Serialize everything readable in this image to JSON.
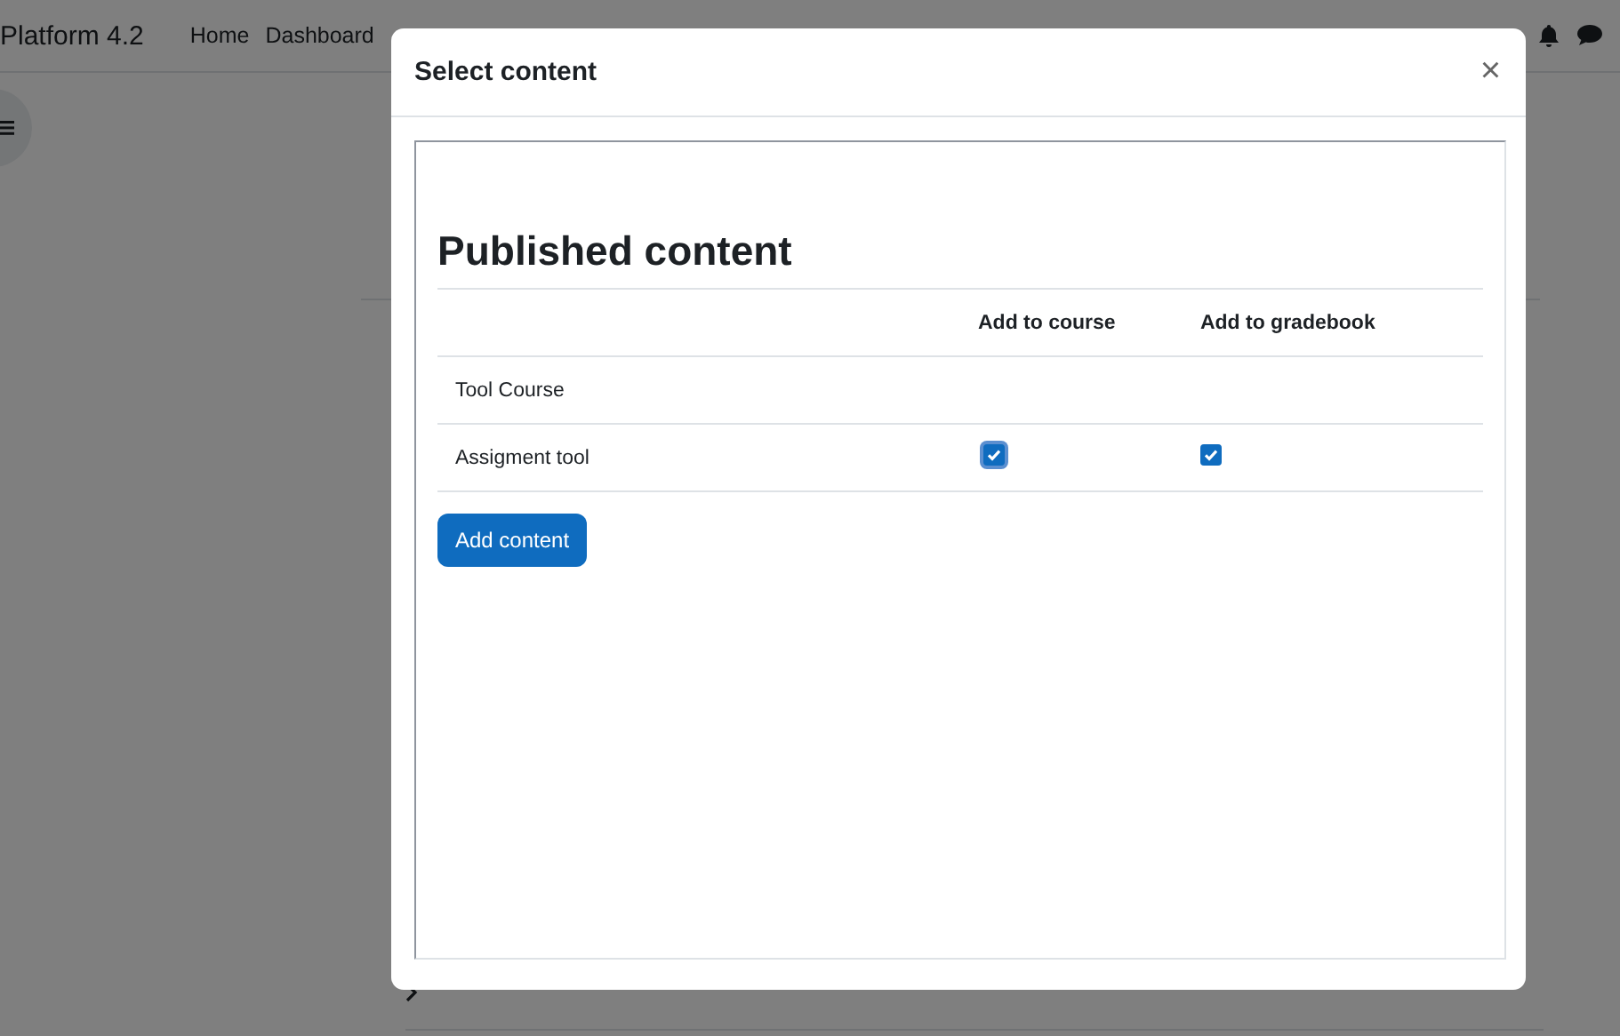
{
  "navbar": {
    "brand": "Platform 4.2",
    "links": [
      "Home",
      "Dashboard"
    ]
  },
  "dialog": {
    "title": "Select content",
    "close": "×",
    "heading": "Published content",
    "columns": [
      "Add to course",
      "Add to gradebook"
    ],
    "rows": [
      {
        "name": "Tool Course"
      },
      {
        "name": "Assigment tool",
        "checkboxes": [
          {
            "checked": true,
            "focused": true
          },
          {
            "checked": true,
            "focused": false
          }
        ]
      }
    ],
    "button": "Add content"
  }
}
